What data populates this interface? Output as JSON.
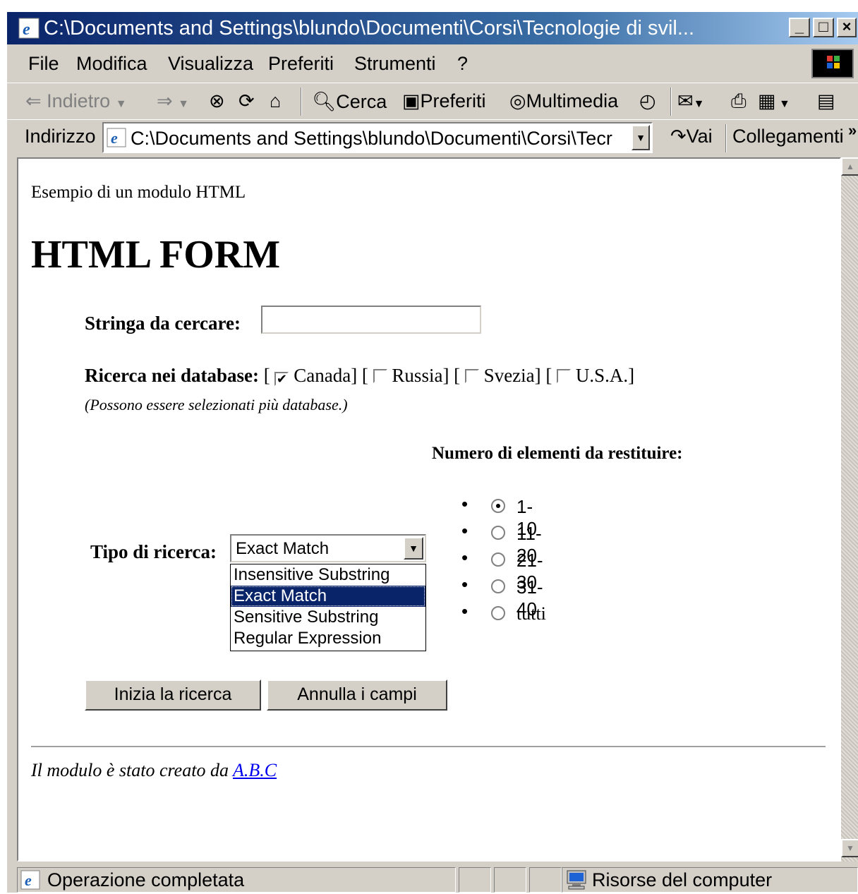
{
  "window": {
    "title": "C:\\Documents and Settings\\blundo\\Documenti\\Corsi\\Tecnologie di svil...",
    "min_label": "_",
    "max_label": "□",
    "close_label": "×"
  },
  "menubar": [
    "File",
    "Modifica",
    "Visualizza",
    "Preferiti",
    "Strumenti",
    "?"
  ],
  "toolbar": {
    "back": "Indietro",
    "search": "Cerca",
    "favorites": "Preferiti",
    "media": "Multimedia"
  },
  "address": {
    "label": "Indirizzo",
    "value": "C:\\Documents and Settings\\blundo\\Documenti\\Corsi\\Tecr",
    "go": "Vai",
    "links": "Collegamenti",
    "more": "»"
  },
  "page": {
    "intro": "Esempio di un modulo HTML",
    "heading": "HTML FORM",
    "search_label": "Stringa da cercare:",
    "search_value": "",
    "db_label": "Ricerca nei database:",
    "databases": [
      {
        "name": "Canada",
        "checked": true
      },
      {
        "name": "Russia",
        "checked": false
      },
      {
        "name": "Svezia",
        "checked": false
      },
      {
        "name": "U.S.A.",
        "checked": false
      }
    ],
    "db_note": "(Possono essere selezionati più database.)",
    "count_label": "Numero di elementi da restituire:",
    "count_options": [
      {
        "label": "1-10",
        "checked": true
      },
      {
        "label": "11-20",
        "checked": false
      },
      {
        "label": "21-30",
        "checked": false
      },
      {
        "label": "31-40",
        "checked": false
      },
      {
        "label": "tutti",
        "checked": false
      }
    ],
    "type_label": "Tipo di ricerca:",
    "type_selected": "Exact Match",
    "type_options": [
      "Insensitive Substring",
      "Exact Match",
      "Sensitive Substring",
      "Regular Expression"
    ],
    "submit": "Inizia la ricerca",
    "reset": "Annulla i campi",
    "footer_prefix": "Il modulo è stato creato da",
    "footer_link": "A.B.C"
  },
  "status": {
    "message": "Operazione completata",
    "zone": "Risorse del computer"
  }
}
